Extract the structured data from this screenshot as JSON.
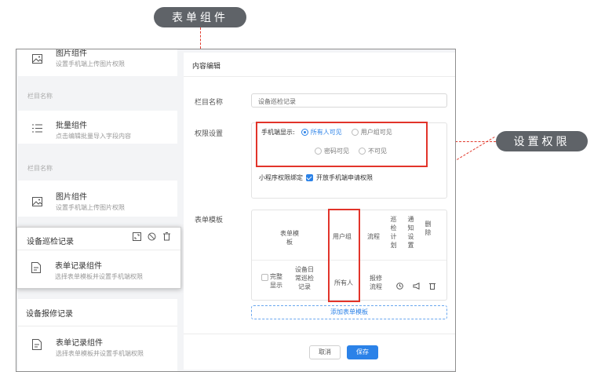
{
  "callouts": {
    "title": "表单组件",
    "permission": "设置权限"
  },
  "sidebar": {
    "image_top": {
      "title": "图片组件",
      "desc": "设置手机端上传图片权限"
    },
    "section1_label": "栏目名称",
    "batch": {
      "title": "批量组件",
      "desc": "点击编辑批量导入字段内容"
    },
    "section2_label": "栏目名称",
    "image2": {
      "title": "图片组件",
      "desc": "设置手机端上传图片权限"
    },
    "inspection": {
      "title": "设备巡检记录",
      "item": {
        "title": "表单记录组件",
        "desc": "选择表单模板并设置手机端权限"
      }
    },
    "repair": {
      "title": "设备报修记录",
      "item": {
        "title": "表单记录组件",
        "desc": "选择表单模板并设置手机端权限"
      }
    }
  },
  "editor": {
    "title": "内容编辑",
    "column_name_label": "栏目名称",
    "column_name_value": "设备巡检记录",
    "permission_label": "权限设置",
    "mobile_display_label": "手机端显示:",
    "options": [
      "所有人可见",
      "用户组可见",
      "密码可见",
      "不可见"
    ],
    "selected_option": "所有人可见",
    "miniprogram_label": "小程序权限绑定",
    "open_mobile_label": "开放手机端申请权限",
    "form_template_label": "表单模板",
    "table": {
      "headers": [
        "表单模板",
        "用户组",
        "流程",
        "巡检计划",
        "通知设置",
        "删除"
      ],
      "row": {
        "full_display": "完整显示",
        "template": "设备日常巡检记录",
        "user_group": "所有人",
        "flow": "报修流程"
      }
    },
    "add_template": "添加表单模板",
    "cancel": "取消",
    "save": "保存"
  },
  "colors": {
    "accent": "#2b82e8",
    "highlight": "#e2342a",
    "pill": "#5f6368"
  }
}
